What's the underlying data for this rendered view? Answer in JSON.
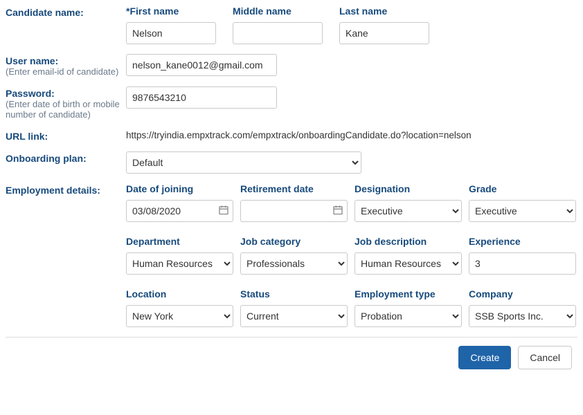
{
  "labels": {
    "candidate_name": "Candidate name:",
    "first_name": "*First name",
    "middle_name": "Middle name",
    "last_name": "Last name",
    "user_name": "User name:",
    "user_name_hint": "(Enter email-id of candidate)",
    "password": "Password:",
    "password_hint": "(Enter date of birth or mobile number of candidate)",
    "url_link": "URL link:",
    "onboarding_plan": "Onboarding plan:",
    "employment_details": "Employment details:",
    "date_of_joining": "Date of joining",
    "retirement_date": "Retirement date",
    "designation": "Designation",
    "grade": "Grade",
    "department": "Department",
    "job_category": "Job category",
    "job_description": "Job description",
    "experience": "Experience",
    "location": "Location",
    "status": "Status",
    "employment_type": "Employment type",
    "company": "Company"
  },
  "values": {
    "first_name": "Nelson",
    "middle_name": "",
    "last_name": "Kane",
    "user_name": "nelson_kane0012@gmail.com",
    "password": "9876543210",
    "url_base": "https://tryindia.empxtrack.com/empxtrack/onboardingCandidate.do?location=",
    "url_param": "nelson",
    "onboarding_plan": "Default",
    "date_of_joining": "03/08/2020",
    "retirement_date": "",
    "designation": "Executive",
    "grade": "Executive",
    "department": "Human Resources",
    "job_category": "Professionals",
    "job_description": "Human Resources",
    "experience": "3",
    "location": "New York",
    "status": "Current",
    "employment_type": "Probation",
    "company": "SSB Sports Inc."
  },
  "buttons": {
    "create": "Create",
    "cancel": "Cancel"
  }
}
